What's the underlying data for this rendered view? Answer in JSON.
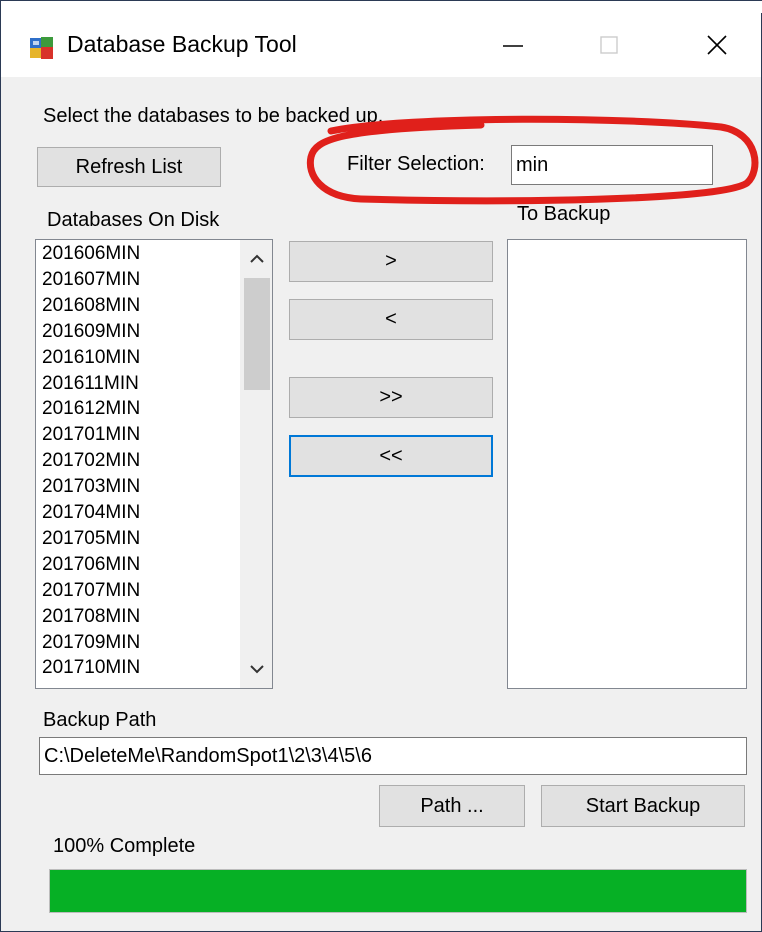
{
  "window": {
    "title": "Database Backup Tool",
    "controls": [
      "minimize-icon",
      "maximize-icon",
      "close-icon"
    ]
  },
  "instructions": "Select the databases to be backed up.",
  "refresh_button": "Refresh List",
  "filter": {
    "label": "Filter Selection:",
    "value": "min"
  },
  "databases_on_disk": {
    "label": "Databases On Disk",
    "items": [
      "201606MIN",
      "201607MIN",
      "201608MIN",
      "201609MIN",
      "201610MIN",
      "201611MIN",
      "201612MIN",
      "201701MIN",
      "201702MIN",
      "201703MIN",
      "201704MIN",
      "201705MIN",
      "201706MIN",
      "201707MIN",
      "201708MIN",
      "201709MIN",
      "201710MIN"
    ]
  },
  "to_backup": {
    "label": "To Backup",
    "items": []
  },
  "transfer_buttons": {
    "add": ">",
    "remove": "<",
    "add_all": ">>",
    "remove_all": "<<"
  },
  "backup_path": {
    "label": "Backup Path",
    "value": "C:\\DeleteMe\\RandomSpot1\\2\\3\\4\\5\\6"
  },
  "path_button": "Path ...",
  "start_button": "Start Backup",
  "progress": {
    "text": "100% Complete",
    "fraction": 1.0,
    "color": "#06b025"
  },
  "colors": {
    "annotation": "#e0201b",
    "focus": "#0078d7"
  }
}
